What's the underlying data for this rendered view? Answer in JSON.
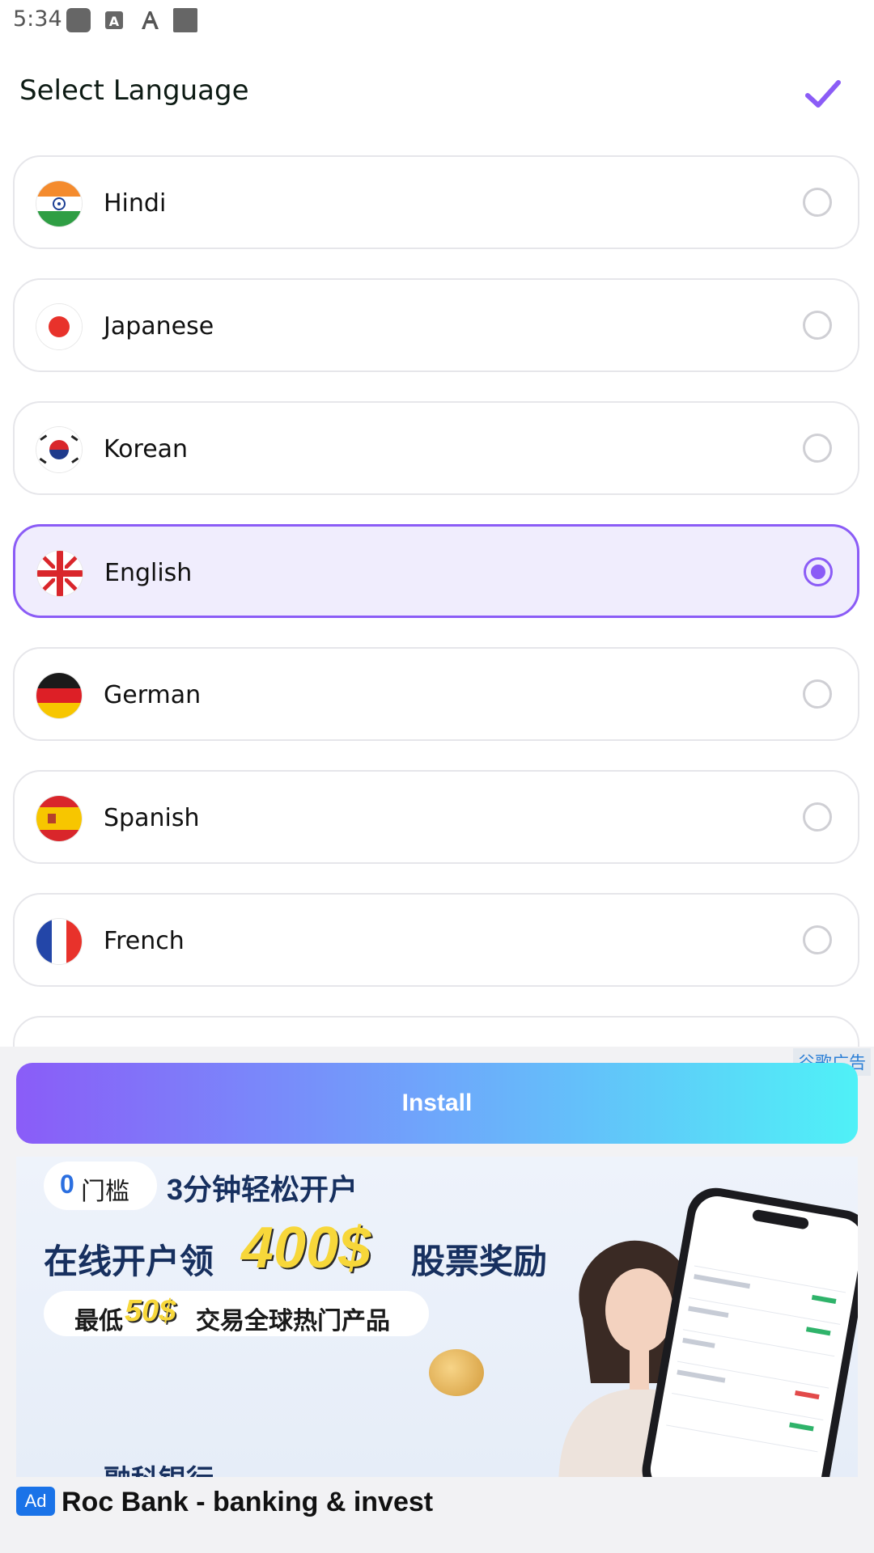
{
  "status_bar": {
    "time": "5:34",
    "icons": [
      "notification-icon",
      "font-icon",
      "text-icon",
      "square-icon"
    ]
  },
  "header": {
    "title": "Select Language",
    "confirm_icon": "checkmark-icon",
    "accent_color": "#8b5cf6"
  },
  "languages": [
    {
      "label": "Hindi",
      "flag": "india-flag-icon",
      "selected": false
    },
    {
      "label": "Japanese",
      "flag": "japan-flag-icon",
      "selected": false
    },
    {
      "label": "Korean",
      "flag": "korea-flag-icon",
      "selected": false
    },
    {
      "label": "English",
      "flag": "uk-flag-icon",
      "selected": true
    },
    {
      "label": "German",
      "flag": "germany-flag-icon",
      "selected": false
    },
    {
      "label": "Spanish",
      "flag": "spain-flag-icon",
      "selected": false
    },
    {
      "label": "French",
      "flag": "france-flag-icon",
      "selected": false
    }
  ],
  "ad": {
    "attribution": "谷歌广告",
    "install_label": "Install",
    "banner": {
      "pill_zero": "0",
      "pill_text": "门槛",
      "line1": "3分钟轻松开户",
      "line2_a": "在线开户领",
      "line2_amount": "400$",
      "line2_b": "股票奖励",
      "line3_a": "最低",
      "line3_amount": "50$",
      "line3_b": "交易全球热门产品",
      "brand_partial": "融科银行"
    },
    "badge": "Ad",
    "app_name": "Roc Bank - banking & invest"
  }
}
